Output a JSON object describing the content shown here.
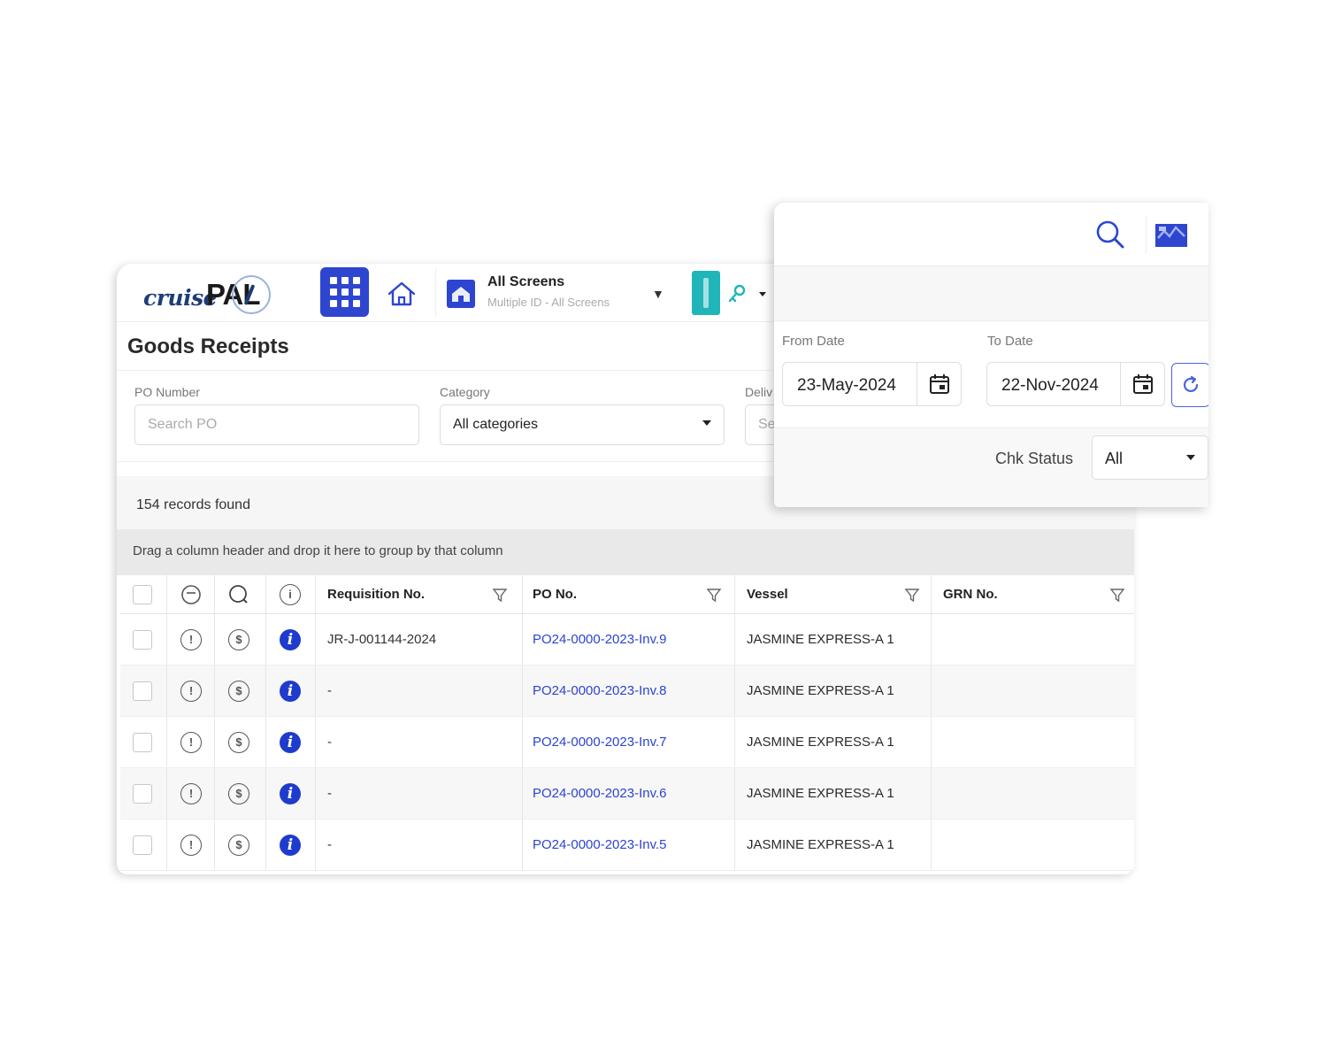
{
  "logo": {
    "text_cruise": "cruise",
    "text_pal": "PAL"
  },
  "header": {
    "screens_title": "All Screens",
    "screens_subtitle": "Multiple ID - All Screens"
  },
  "page": {
    "title": "Goods Receipts"
  },
  "filters": {
    "po_label": "PO Number",
    "po_placeholder": "Search PO",
    "category_label": "Category",
    "category_value": "All categories",
    "delivery_label_partial": "Deliv",
    "delivery_value_partial": "Se"
  },
  "panel": {
    "from_label": "From Date",
    "from_value": "23-May-2024",
    "to_label": "To Date",
    "to_value": "22-Nov-2024",
    "chk_status_label": "Chk Status",
    "chk_status_value": "All"
  },
  "grid": {
    "records_found": "154 records found",
    "group_hint": "Drag a column header and drop it here to group by that column",
    "columns": [
      "Requisition No.",
      "PO No.",
      "Vessel",
      "GRN No."
    ],
    "rows": [
      {
        "requisition": "JR-J-001144-2024",
        "po": "PO24-0000-2023-Inv.9",
        "vessel": "JASMINE EXPRESS-A 1",
        "grn": ""
      },
      {
        "requisition": "-",
        "po": "PO24-0000-2023-Inv.8",
        "vessel": "JASMINE EXPRESS-A 1",
        "grn": ""
      },
      {
        "requisition": "-",
        "po": "PO24-0000-2023-Inv.7",
        "vessel": "JASMINE EXPRESS-A 1",
        "grn": ""
      },
      {
        "requisition": "-",
        "po": "PO24-0000-2023-Inv.6",
        "vessel": "JASMINE EXPRESS-A 1",
        "grn": ""
      },
      {
        "requisition": "-",
        "po": "PO24-0000-2023-Inv.5",
        "vessel": "JASMINE EXPRESS-A 1",
        "grn": ""
      }
    ]
  },
  "colors": {
    "primary": "#2e45d0",
    "link": "#2c44cf",
    "teal": "#20b5b8",
    "info": "#1f3bcd"
  },
  "icons": [
    "apps-grid-icon",
    "home-icon",
    "screens-icon",
    "key-icon",
    "search-icon",
    "map-icon",
    "calendar-icon",
    "refresh-icon",
    "filter-icon",
    "info-icon"
  ]
}
